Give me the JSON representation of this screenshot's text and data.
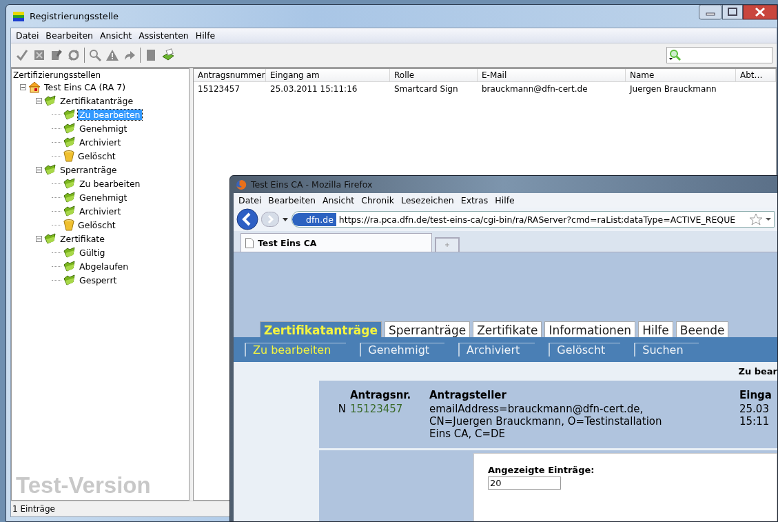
{
  "main_window": {
    "title": "Registrierungsstelle",
    "menu": [
      "Datei",
      "Bearbeiten",
      "Ansicht",
      "Assistenten",
      "Hilfe"
    ],
    "tree": {
      "header": "Zertifizierungsstellen",
      "root": {
        "label": "Test Eins CA (RA 7)",
        "kind": "house",
        "expanded": true,
        "selected": false,
        "children": [
          {
            "label": "Zertifikatanträge",
            "kind": "folder",
            "expanded": true,
            "selected": false,
            "children": [
              {
                "label": "Zu bearbeiten",
                "kind": "folder",
                "selected": true
              },
              {
                "label": "Genehmigt",
                "kind": "folder",
                "selected": false
              },
              {
                "label": "Archiviert",
                "kind": "folder",
                "selected": false
              },
              {
                "label": "Gelöscht",
                "kind": "trash",
                "selected": false
              }
            ]
          },
          {
            "label": "Sperranträge",
            "kind": "folder",
            "expanded": true,
            "selected": false,
            "children": [
              {
                "label": "Zu bearbeiten",
                "kind": "folder",
                "selected": false
              },
              {
                "label": "Genehmigt",
                "kind": "folder",
                "selected": false
              },
              {
                "label": "Archiviert",
                "kind": "folder",
                "selected": false
              },
              {
                "label": "Gelöscht",
                "kind": "trash",
                "selected": false
              }
            ]
          },
          {
            "label": "Zertifikate",
            "kind": "folder",
            "expanded": true,
            "selected": false,
            "children": [
              {
                "label": "Gültig",
                "kind": "folder",
                "selected": false
              },
              {
                "label": "Abgelaufen",
                "kind": "folder",
                "selected": false
              },
              {
                "label": "Gesperrt",
                "kind": "folder",
                "selected": false
              }
            ]
          }
        ]
      }
    },
    "edition_label": "Test-Version",
    "table": {
      "columns": [
        "Antragsnummer",
        "Eingang am",
        "Rolle",
        "E-Mail",
        "Name",
        "Abt…"
      ],
      "rows": [
        [
          "15123457",
          "25.03.2011 15:11:16",
          "Smartcard Sign",
          "brauckmann@dfn-cert.de",
          "Juergen Brauckmann",
          ""
        ]
      ]
    },
    "status_bar": "1 Einträge"
  },
  "browser": {
    "title": "Test Eins CA - Mozilla Firefox",
    "menu": [
      "Datei",
      "Bearbeiten",
      "Ansicht",
      "Chronik",
      "Lesezeichen",
      "Extras",
      "Hilfe"
    ],
    "site_badge": "dfn.de",
    "url": "https://ra.pca.dfn.de/test-eins-ca/cgi-bin/ra/RAServer?cmd=raList;dataType=ACTIVE_REQUE",
    "tabs": [
      {
        "label": "Test Eins CA",
        "selected": true
      }
    ],
    "page": {
      "nav_tabs": [
        {
          "label": "Zertifikatanträge",
          "selected": true
        },
        {
          "label": "Sperranträge",
          "selected": false
        },
        {
          "label": "Zertifikate",
          "selected": false
        },
        {
          "label": "Informationen",
          "selected": false
        },
        {
          "label": "Hilfe",
          "selected": false
        },
        {
          "label": "Beende",
          "selected": false
        }
      ],
      "sub_tabs": [
        {
          "label": "Zu bearbeiten",
          "selected": true
        },
        {
          "label": "Genehmigt",
          "selected": false
        },
        {
          "label": "Archiviert",
          "selected": false
        },
        {
          "label": "Gelöscht",
          "selected": false
        },
        {
          "label": "Suchen",
          "selected": false
        }
      ],
      "heading": "Zu bear",
      "request_headers": [
        "Antragsnr.",
        "Antragsteller",
        "Einga"
      ],
      "request": {
        "flag": "N",
        "number": "15123457",
        "applicant": [
          "emailAddress=brauckmann@dfn-cert.de,",
          "CN=Juergen Brauckmann, O=Testinstallation",
          "Eins CA, C=DE"
        ],
        "received": [
          "25.03",
          "15:11"
        ]
      },
      "form": {
        "label": "Angezeigte Einträge:",
        "value": "20"
      }
    }
  }
}
